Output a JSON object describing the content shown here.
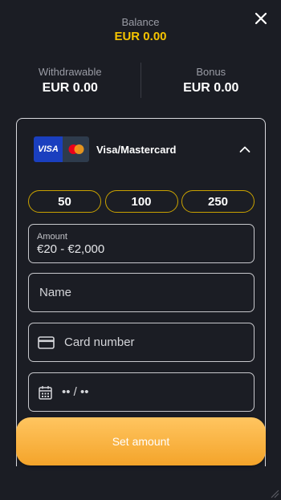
{
  "balance": {
    "label": "Balance",
    "value": "EUR 0.00"
  },
  "withdrawable": {
    "label": "Withdrawable",
    "value": "EUR 0.00"
  },
  "bonus": {
    "label": "Bonus",
    "value": "EUR 0.00"
  },
  "payment_method": {
    "name": "Visa/Mastercard",
    "visa_logo_text": "VISA",
    "icons": [
      "visa-logo",
      "mastercard-logo",
      "chevron-up-icon"
    ]
  },
  "quick_amounts": [
    "50",
    "100",
    "250"
  ],
  "fields": {
    "amount_label": "Amount",
    "amount_range": "€20 - €2,000",
    "name_placeholder": "Name",
    "card_number_placeholder": "Card number",
    "expiry_placeholder": "•• / ••"
  },
  "cta": {
    "label": "Set amount"
  },
  "colors": {
    "background": "#1b1d24",
    "balance_accent": "#f5c400",
    "chip_border": "#c9a200",
    "button_gradient_top": "#ffc560",
    "button_gradient_bottom": "#f4a42a"
  }
}
